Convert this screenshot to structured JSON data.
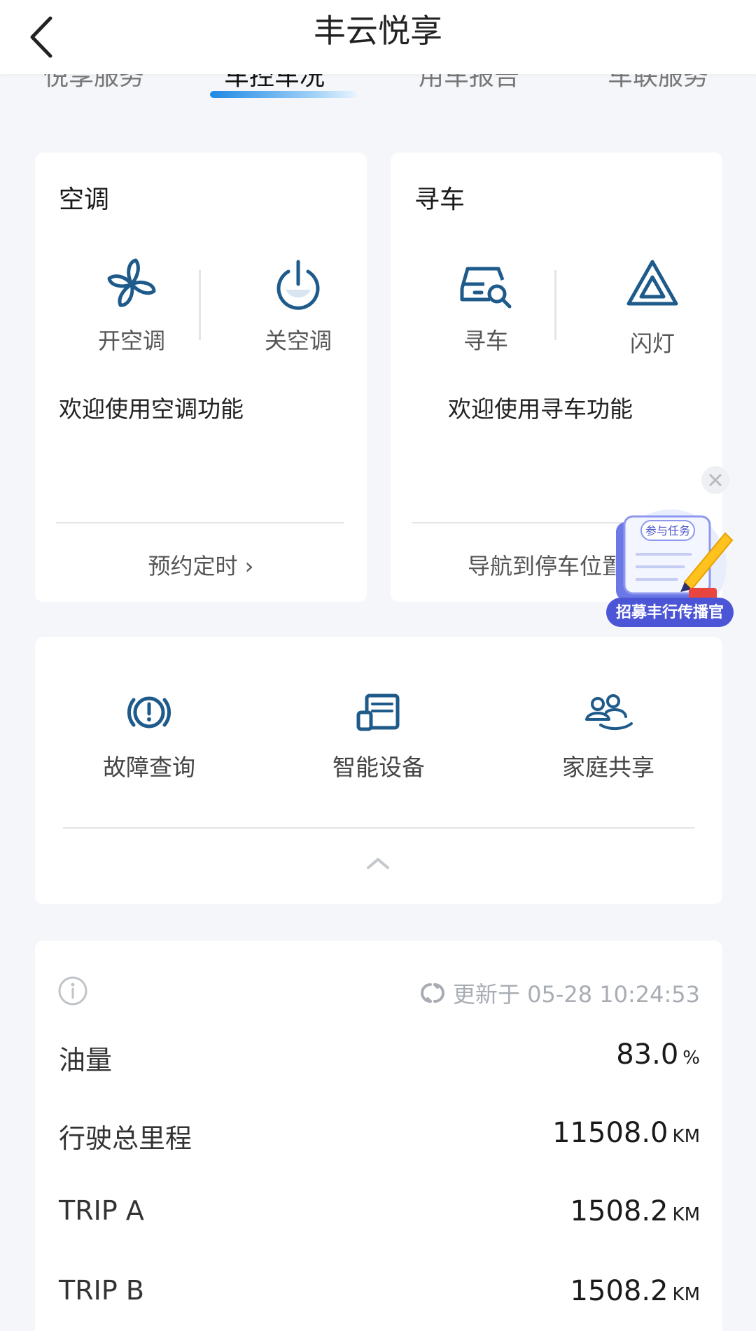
{
  "header": {
    "title": "丰云悦享"
  },
  "tabs": [
    {
      "label": "悦享服务",
      "active": false
    },
    {
      "label": "车控车况",
      "active": true
    },
    {
      "label": "用车报告",
      "active": false
    },
    {
      "label": "车联服务",
      "active": false
    }
  ],
  "ac_card": {
    "title": "空调",
    "on_label": "开空调",
    "off_label": "关空调",
    "welcome": "欢迎使用空调功能",
    "footer": "预约定时 ›"
  },
  "find_card": {
    "title": "寻车",
    "find_label": "寻车",
    "flash_label": "闪灯",
    "welcome": "欢迎使用寻车功能",
    "footer": "导航到停车位置"
  },
  "promo": {
    "tag": "参与任务",
    "banner": "招募丰行传播官"
  },
  "tools": [
    {
      "label": "故障查询",
      "icon": "fault-warning-icon"
    },
    {
      "label": "智能设备",
      "icon": "smart-device-icon"
    },
    {
      "label": "家庭共享",
      "icon": "family-share-icon"
    }
  ],
  "status": {
    "updated": "更新于 05-28 10:24:53",
    "rows": [
      {
        "label": "油量",
        "value": "83.0",
        "unit": "%"
      },
      {
        "label": "行驶总里程",
        "value": "11508.0",
        "unit": "KM"
      },
      {
        "label": "TRIP A",
        "value": "1508.2",
        "unit": "KM"
      },
      {
        "label": "TRIP B",
        "value": "1508.2",
        "unit": "KM"
      }
    ]
  },
  "colors": {
    "accent": "#1e5a8a",
    "tab_accent": "#1e88e5",
    "background": "#f4f6f9"
  }
}
